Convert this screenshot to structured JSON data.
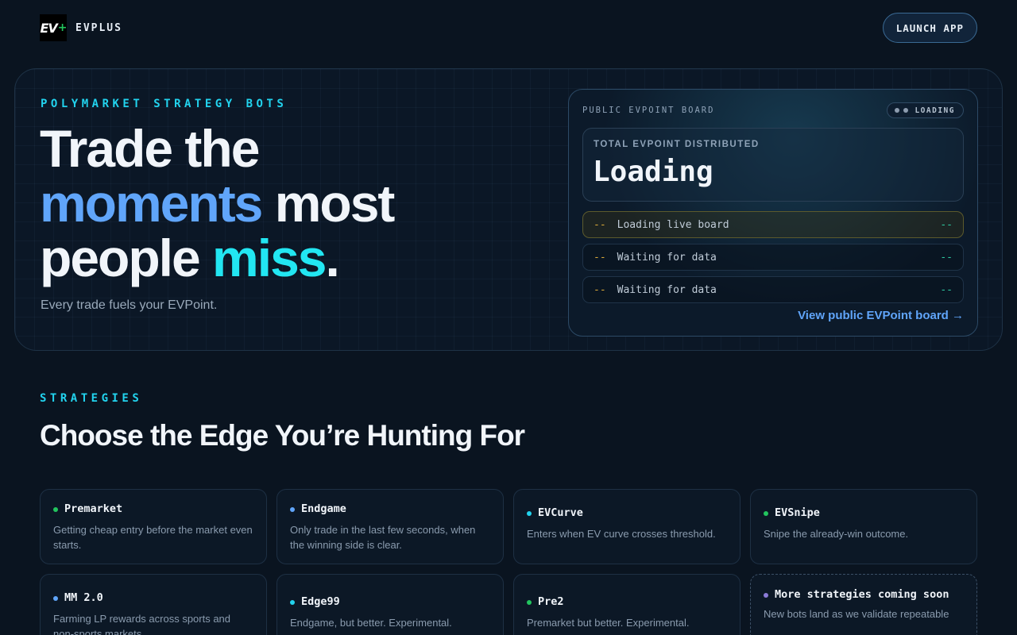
{
  "nav": {
    "logo_text": "EV",
    "logo_plus": "+",
    "brand": "EVPLUS",
    "launch": "LAUNCH APP"
  },
  "hero": {
    "eyebrow": "POLYMARKET STRATEGY BOTS",
    "line1": "Trade the",
    "line2_accent": "moments",
    "line2_rest": " most",
    "line3_start": "people ",
    "line3_accent": "miss",
    "line3_end": ".",
    "subtitle": "Every trade fuels your EVPoint."
  },
  "board": {
    "title": "PUBLIC EVPOINT BOARD",
    "status": "LOADING",
    "total_label": "TOTAL EVPOINT DISTRIBUTED",
    "total_value": "Loading",
    "rows": [
      {
        "dash": "--",
        "text": "Loading live board",
        "value": "--"
      },
      {
        "dash": "--",
        "text": "Waiting for data",
        "value": "--"
      },
      {
        "dash": "--",
        "text": "Waiting for data",
        "value": "--"
      }
    ],
    "link": "View public EVPoint board →"
  },
  "strategies": {
    "eyebrow": "STRATEGIES",
    "title": "Choose the Edge You’re Hunting For",
    "cards": [
      {
        "name": "Premarket",
        "desc": "Getting cheap entry before the market even starts.",
        "color": "#22c55e"
      },
      {
        "name": "Endgame",
        "desc": "Only trade in the last few seconds, when the winning side is clear.",
        "color": "#60a5fa"
      },
      {
        "name": "EVCurve",
        "desc": "Enters when EV curve crosses threshold.",
        "color": "#22d3ee"
      },
      {
        "name": "EVSnipe",
        "desc": "Snipe the already-win outcome.",
        "color": "#22c55e"
      },
      {
        "name": "MM 2.0",
        "desc": "Farming LP rewards across sports and non-sports markets.",
        "color": "#60a5fa"
      },
      {
        "name": "Edge99",
        "desc": "Endgame, but better. Experimental.",
        "color": "#22d3ee"
      },
      {
        "name": "Pre2",
        "desc": "Premarket but better. Experimental.",
        "color": "#22c55e"
      },
      {
        "name": "More strategies coming soon",
        "desc": "New bots land as we validate repeatable",
        "color": "#8b7bd8"
      }
    ]
  }
}
